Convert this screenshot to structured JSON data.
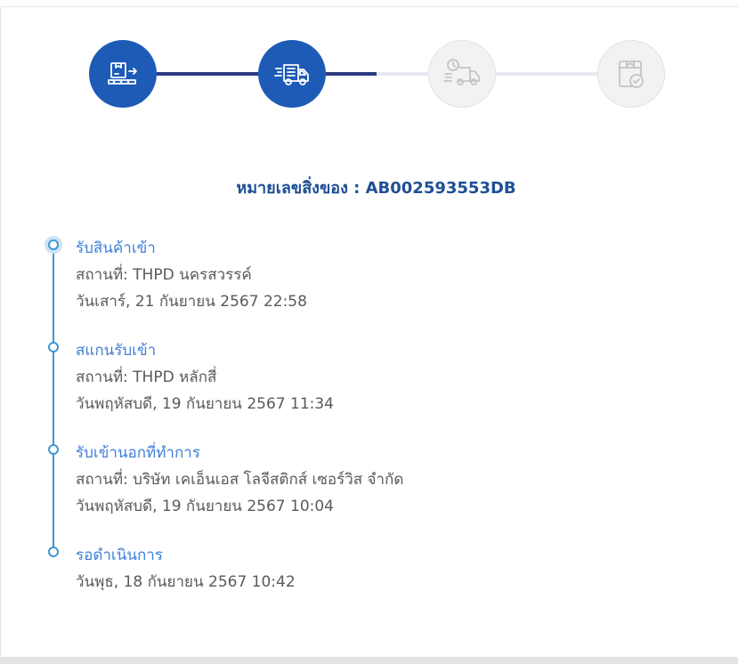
{
  "stepper": {
    "steps": [
      {
        "icon": "package-dispatch-icon",
        "state": "done"
      },
      {
        "icon": "delivery-truck-icon",
        "state": "done"
      },
      {
        "icon": "scheduled-truck-icon",
        "state": "pending"
      },
      {
        "icon": "package-check-icon",
        "state": "pending"
      }
    ]
  },
  "tracking": {
    "label": "หมายเลขสิ่งของ : AB002593553DB"
  },
  "events": [
    {
      "title": "รับสินค้าเข้า",
      "location": "สถานที่: THPD นครสวรรค์",
      "datetime": "วันเสาร์, 21 กันยายน 2567 22:58"
    },
    {
      "title": "สแกนรับเข้า",
      "location": "สถานที่: THPD หลักสี่",
      "datetime": "วันพฤหัสบดี, 19 กันยายน 2567 11:34"
    },
    {
      "title": "รับเข้านอกที่ทำการ",
      "location": "สถานที่: บริษัท เคเอ็นเอส โลจีสติกส์ เซอร์วิส จำกัด",
      "datetime": "วันพฤหัสบดี, 19 กันยายน 2567 10:04"
    },
    {
      "title": "รอดำเนินการ",
      "datetime": "วันพุธ, 18 กันยายน 2567 10:42"
    }
  ],
  "colors": {
    "step_done": "#1d5bb6",
    "line_done": "#2c3b82",
    "step_pending": "#f2f2f2",
    "tracking_text": "#1f4f94",
    "event_title": "#3e7fd6",
    "timeline": "#3e98d0"
  }
}
